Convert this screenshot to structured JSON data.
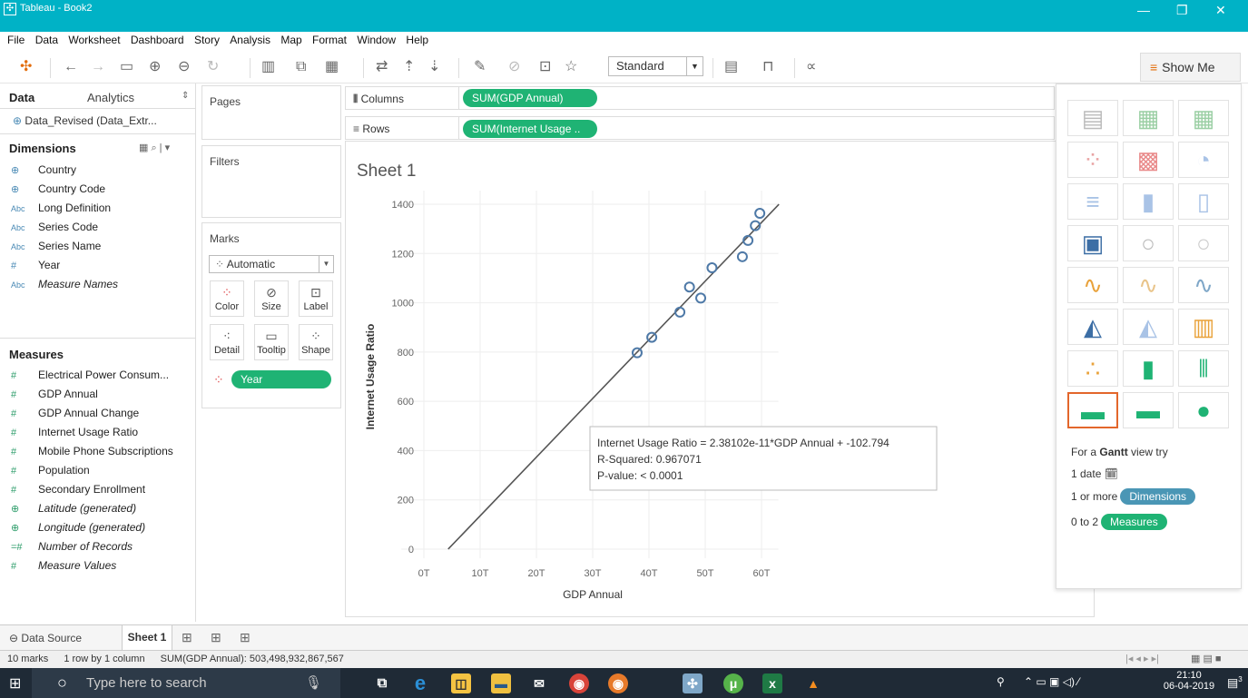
{
  "window": {
    "title": "Tableau - Book2",
    "minimize": "—",
    "maximize": "❐",
    "close": "✕"
  },
  "menu": [
    "File",
    "Data",
    "Worksheet",
    "Dashboard",
    "Story",
    "Analysis",
    "Map",
    "Format",
    "Window",
    "Help"
  ],
  "toolbar": {
    "fit_select": "Standard",
    "show_me": "Show Me"
  },
  "data_pane": {
    "tab_data": "Data",
    "tab_analytics": "Analytics",
    "datasource": "Data_Revised (Data_Extr...",
    "dimensions_header": "Dimensions",
    "dimensions": [
      {
        "type": "globe",
        "name": "Country"
      },
      {
        "type": "globe",
        "name": "Country Code"
      },
      {
        "type": "Abc",
        "name": "Long Definition"
      },
      {
        "type": "Abc",
        "name": "Series Code"
      },
      {
        "type": "Abc",
        "name": "Series Name"
      },
      {
        "type": "#",
        "name": "Year"
      },
      {
        "type": "Abc",
        "name": "Measure Names"
      }
    ],
    "measures_header": "Measures",
    "measures": [
      {
        "type": "#",
        "name": "Electrical Power Consum..."
      },
      {
        "type": "#",
        "name": "GDP Annual"
      },
      {
        "type": "#",
        "name": "GDP Annual Change"
      },
      {
        "type": "#",
        "name": "Internet Usage Ratio"
      },
      {
        "type": "#",
        "name": "Mobile Phone Subscriptions"
      },
      {
        "type": "#",
        "name": "Population"
      },
      {
        "type": "#",
        "name": "Secondary Enrollment"
      },
      {
        "type": "globe",
        "name": "Latitude (generated)"
      },
      {
        "type": "globe",
        "name": "Longitude (generated)"
      },
      {
        "type": "=#",
        "name": "Number of Records"
      },
      {
        "type": "#",
        "name": "Measure Values"
      }
    ]
  },
  "shelves": {
    "pages": "Pages",
    "filters": "Filters",
    "marks": "Marks",
    "mark_type": "Automatic",
    "mark_buttons": [
      "Color",
      "Size",
      "Label",
      "Detail",
      "Tooltip",
      "Shape"
    ],
    "mark_pill": "Year",
    "columns_label": "Columns",
    "columns_pill": "SUM(GDP Annual)",
    "rows_label": "Rows",
    "rows_pill": "SUM(Internet Usage .."
  },
  "sheet": {
    "title": "Sheet 1"
  },
  "chart_data": {
    "type": "scatter",
    "xlabel": "GDP Annual",
    "ylabel": "Internet Usage Ratio",
    "x_ticks": [
      "0T",
      "10T",
      "20T",
      "30T",
      "40T",
      "50T",
      "60T"
    ],
    "y_ticks": [
      "0",
      "200",
      "400",
      "600",
      "800",
      "1000",
      "1200",
      "1400"
    ],
    "xlim": [
      0,
      60
    ],
    "ylim": [
      0,
      1400
    ],
    "x_units": "trillions",
    "points": [
      {
        "x": 37.9,
        "y": 797
      },
      {
        "x": 40.5,
        "y": 860
      },
      {
        "x": 45.5,
        "y": 962
      },
      {
        "x": 47.2,
        "y": 1064
      },
      {
        "x": 49.2,
        "y": 1019
      },
      {
        "x": 51.2,
        "y": 1142
      },
      {
        "x": 56.6,
        "y": 1187
      },
      {
        "x": 57.6,
        "y": 1253
      },
      {
        "x": 58.9,
        "y": 1313
      },
      {
        "x": 59.7,
        "y": 1363
      }
    ],
    "trend_line": {
      "slope_per_trillion": 23.8102,
      "intercept": -102.794,
      "x_range": [
        4.32,
        63.1
      ]
    },
    "tooltip": [
      "Internet Usage Ratio = 2.38102e-11*GDP Annual + -102.794",
      "R-Squared: 0.967071",
      "P-value: < 0.0001"
    ],
    "grid": true,
    "colors": {
      "marks": "#4e79a7",
      "trend": "#555555"
    }
  },
  "show_me": {
    "hint_prefix": "For a",
    "hint_bold": "Gantt",
    "hint_suffix": "view try",
    "req1": "1 date",
    "req2_prefix": "1 or more",
    "req2_pill": "Dimensions",
    "req3_prefix": "0 to 2",
    "req3_pill": "Measures"
  },
  "tabs": {
    "data_source": "Data Source",
    "sheet": "Sheet 1"
  },
  "status": {
    "marks": "10 marks",
    "rows_cols": "1 row by 1 column",
    "sum": "SUM(GDP Annual): 503,498,932,867,567"
  },
  "taskbar": {
    "search_placeholder": "Type here to search",
    "time": "21:10",
    "date": "06-04-2019",
    "notif": "3"
  }
}
